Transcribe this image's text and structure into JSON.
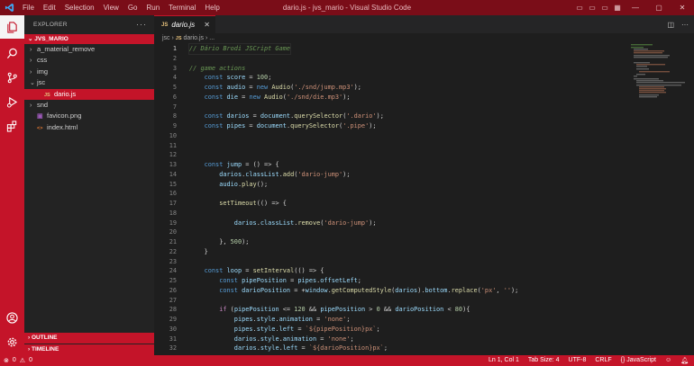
{
  "window": {
    "title": "dario.js - jvs_mario - Visual Studio Code",
    "menu": [
      "File",
      "Edit",
      "Selection",
      "View",
      "Go",
      "Run",
      "Terminal",
      "Help"
    ]
  },
  "sidebar": {
    "header": "EXPLORER",
    "project": "JVS_MARIO",
    "items": [
      {
        "label": "a_material_remove",
        "type": "folder",
        "indent": 1,
        "expanded": false
      },
      {
        "label": "css",
        "type": "folder",
        "indent": 1,
        "expanded": false
      },
      {
        "label": "img",
        "type": "folder",
        "indent": 1,
        "expanded": false
      },
      {
        "label": "jsc",
        "type": "folder",
        "indent": 1,
        "expanded": true
      },
      {
        "label": "dario.js",
        "type": "js",
        "indent": 2,
        "selected": true
      },
      {
        "label": "snd",
        "type": "folder",
        "indent": 1,
        "expanded": false
      },
      {
        "label": "favicon.png",
        "type": "png",
        "indent": 1
      },
      {
        "label": "index.html",
        "type": "html",
        "indent": 1
      }
    ],
    "outline": "OUTLINE",
    "timeline": "TIMELINE"
  },
  "editor": {
    "tab_label": "dario.js",
    "breadcrumb": [
      "jsc",
      "dario.js",
      "..."
    ],
    "current_line": 1
  },
  "status": {
    "errors": "0",
    "warnings": "0",
    "position": "Ln 1, Col 1",
    "tab_size": "Tab Size: 4",
    "encoding": "UTF-8",
    "eol": "CRLF",
    "language": "JavaScript"
  },
  "colors": {
    "accent": "#c41429",
    "titlebar": "#7a0d18",
    "editor_bg": "#1e1e1e",
    "sidebar_bg": "#232323"
  },
  "code_lines": [
    "// Dário Brodi JSCript Game",
    "",
    "// game actions",
    "    const score = 100;",
    "    const audio = new Audio('./snd/jump.mp3');",
    "    const die = new Audio('./snd/die.mp3');",
    "",
    "    const darios = document.querySelector('.dario');",
    "    const pipes = document.querySelector('.pipe');",
    "",
    "",
    "",
    "    const jump = () => {",
    "        darios.classList.add('dario-jump');",
    "        audio.play();",
    "",
    "        setTimeout(() => {",
    "",
    "            darios.classList.remove('dario-jump');",
    "",
    "        }, 500);",
    "    }",
    "",
    "    const loop = setInterval(() => {",
    "        const pipePosition = pipes.offsetLeft;",
    "        const darioPosition = +window.getComputedStyle(darios).bottom.replace('px', '');",
    "",
    "        if (pipePosition <= 120 && pipePosition > 0 && darioPosition < 80){",
    "            pipes.style.animation = 'none';",
    "            pipes.style.left = `${pipePosition}px`;",
    "            darios.style.animation = 'none';",
    "            darios.style.left = `${darioPosition}px`;"
  ]
}
